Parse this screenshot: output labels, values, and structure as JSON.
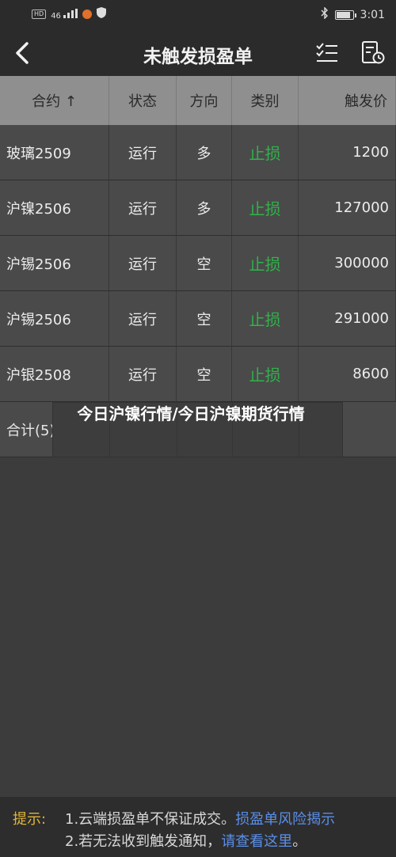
{
  "status_bar": {
    "hd": "HD",
    "signal": "46",
    "time": "3:01",
    "battery_level": 0.9
  },
  "nav": {
    "title": "未触发损盈单",
    "back_icon": "chevron-left-icon",
    "icon1": "checklist-icon",
    "icon2": "order-history-icon"
  },
  "table": {
    "headers": [
      "合约 ↑",
      "状态",
      "方向",
      "类别",
      "触发价"
    ],
    "rows": [
      {
        "contract": "玻璃2509",
        "status": "运行",
        "direction": "多",
        "type": "止损",
        "price": "1200"
      },
      {
        "contract": "沪镍2506",
        "status": "运行",
        "direction": "多",
        "type": "止损",
        "price": "127000"
      },
      {
        "contract": "沪锡2506",
        "status": "运行",
        "direction": "空",
        "type": "止损",
        "price": "300000"
      },
      {
        "contract": "沪锡2506",
        "status": "运行",
        "direction": "空",
        "type": "止损",
        "price": "291000"
      },
      {
        "contract": "沪银2508",
        "status": "运行",
        "direction": "空",
        "type": "止损",
        "price": "8600"
      }
    ],
    "total_label": "合计(5)"
  },
  "overlay_caption": "今日沪镍行情/今日沪镍期货行情",
  "footer": {
    "label": "提示:",
    "line1_text": "1.云端损盈单不保证成交。",
    "line1_link": "损盈单风险揭示",
    "line2_text": "2.若无法收到触发通知，",
    "line2_link": "请查看这里",
    "line2_end": "。"
  },
  "colors": {
    "stop_loss": "#2fb34a",
    "link": "#5b8ee8",
    "tip_label": "#e0b53a"
  }
}
